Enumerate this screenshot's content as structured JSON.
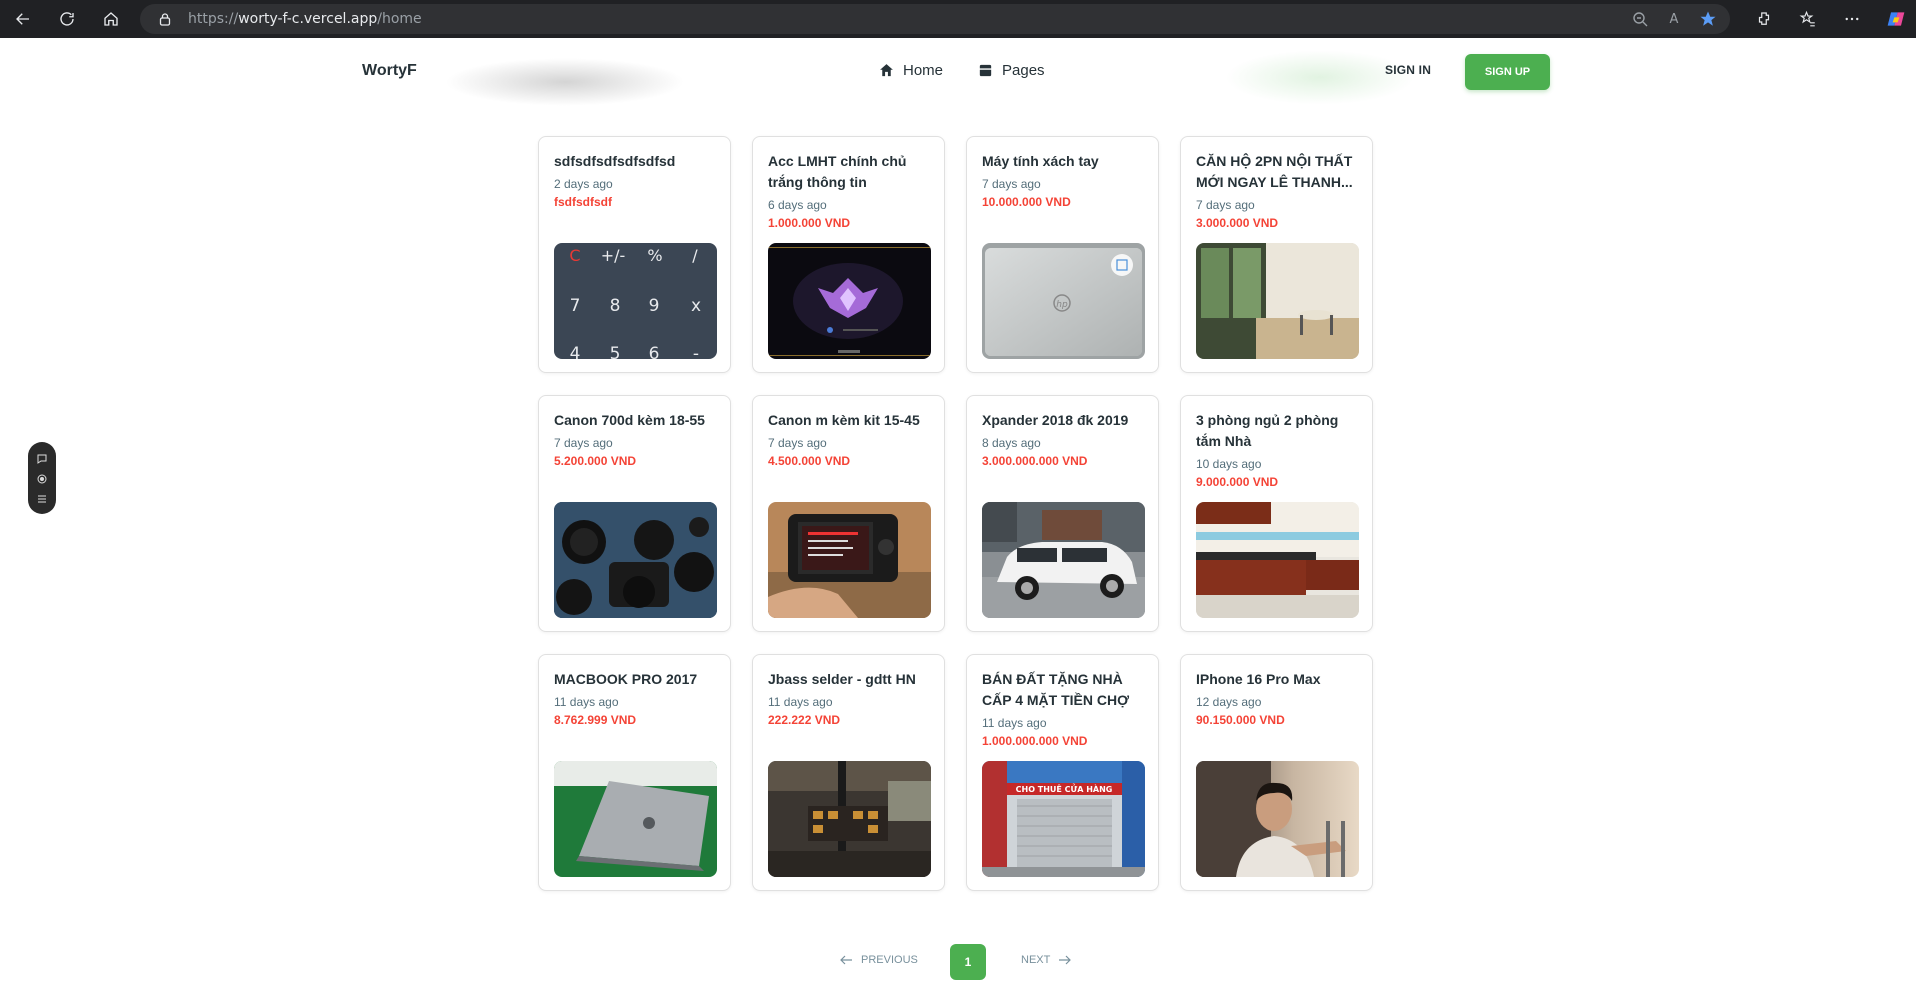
{
  "browser": {
    "url_prefix": "https://",
    "url_host": "worty-f-c.vercel.app",
    "url_path": "/home"
  },
  "nav": {
    "brand": "WortyF",
    "items": [
      {
        "label": "Home",
        "icon": "home-icon"
      },
      {
        "label": "Pages",
        "icon": "pages-icon"
      }
    ],
    "signin": "SIGN IN",
    "signup": "SIGN UP"
  },
  "listings": [
    {
      "title": "sdfsdfsdfsdfsdfsd",
      "time": "2 days ago",
      "price": "fsdfsdfsdf",
      "image": "calculator-image"
    },
    {
      "title": "Acc LMHT chính chủ trắng thông tin",
      "time": "6 days ago",
      "price": "1.000.000 VND",
      "image": "game-screen-image"
    },
    {
      "title": "Máy tính xách tay",
      "time": "7 days ago",
      "price": "10.000.000 VND",
      "image": "laptop-image"
    },
    {
      "title": "CĂN HỘ 2PN NỘI THẤT MỚI NGAY LÊ THANH...",
      "time": "7 days ago",
      "price": "3.000.000 VND",
      "image": "apartment-image"
    },
    {
      "title": "Canon 700d kèm 18-55",
      "time": "7 days ago",
      "price": "5.200.000 VND",
      "image": "camera-lenses-image"
    },
    {
      "title": "Canon m kèm kit 15-45",
      "time": "7 days ago",
      "price": "4.500.000 VND",
      "image": "camera-hand-image"
    },
    {
      "title": "Xpander 2018 đk 2019",
      "time": "8 days ago",
      "price": "3.000.000.000 VND",
      "image": "car-image"
    },
    {
      "title": "3 phòng ngủ 2 phòng tắm Nhà",
      "time": "10 days ago",
      "price": "9.000.000 VND",
      "image": "kitchen-image"
    },
    {
      "title": "MACBOOK PRO 2017",
      "time": "11 days ago",
      "price": "8.762.999 VND",
      "image": "macbook-image"
    },
    {
      "title": "Jbass selder - gdtt HN",
      "time": "11 days ago",
      "price": "222.222 VND",
      "image": "bass-guitar-image"
    },
    {
      "title": "BÁN ĐẤT TẶNG NHÀ CẤP 4 MẶT TIỀN CHỢ",
      "time": "11 days ago",
      "price": "1.000.000.000 VND",
      "image": "storefront-image"
    },
    {
      "title": "IPhone 16 Pro Max",
      "time": "12 days ago",
      "price": "90.150.000 VND",
      "image": "person-image"
    }
  ],
  "calculator_keys": [
    "C",
    "+/-",
    "%",
    "/",
    "7",
    "8",
    "9",
    "x",
    "4",
    "5",
    "6",
    "-"
  ],
  "storefront_sign": "CHO THUÊ CỬA HÀNG",
  "pagination": {
    "previous": "PREVIOUS",
    "current": "1",
    "next": "NEXT"
  },
  "colors": {
    "accent_green": "#4caf50",
    "price_red": "#f44336",
    "text_dark": "#263238"
  }
}
